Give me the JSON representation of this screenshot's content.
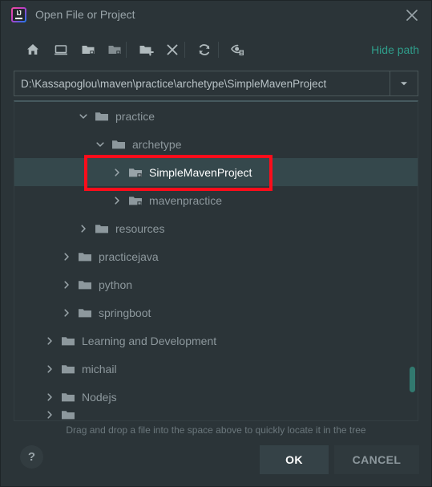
{
  "window": {
    "title": "Open File or Project",
    "app_icon": "intellij-idea-logo",
    "close_icon": "close-icon",
    "background": "#2b3438"
  },
  "toolbar": {
    "buttons": [
      {
        "name": "home-icon",
        "tooltip": "Home"
      },
      {
        "name": "desktop-icon",
        "tooltip": "Desktop"
      },
      {
        "name": "project-folder-icon",
        "tooltip": "Project Directory"
      },
      {
        "name": "folder-up-icon",
        "tooltip": "Up"
      },
      {
        "name": "new-folder-icon",
        "tooltip": "New Folder"
      },
      {
        "name": "delete-icon",
        "tooltip": "Delete"
      },
      {
        "name": "refresh-icon",
        "tooltip": "Refresh"
      },
      {
        "name": "show-hidden-files-icon",
        "tooltip": "Show Hidden Files and Directories"
      }
    ],
    "hide_path_label": "Hide path",
    "hide_path_color": "#2f9e8b"
  },
  "path_field": {
    "value": "D:\\Kassapoglou\\maven\\practice\\archetype\\SimpleMavenProject",
    "placeholder": "",
    "dropdown_icon": "chevron-down-icon"
  },
  "tree": {
    "rows": [
      {
        "label": "practice",
        "depth": 3,
        "arrow": "expanded",
        "icon": "folder-icon",
        "selected": false,
        "clipped": false
      },
      {
        "label": "archetype",
        "depth": 4,
        "arrow": "expanded",
        "icon": "folder-icon",
        "selected": false,
        "clipped": false
      },
      {
        "label": "SimpleMavenProject",
        "depth": 5,
        "arrow": "collapsed",
        "icon": "folder-module-icon",
        "selected": true,
        "clipped": false
      },
      {
        "label": "mavenpractice",
        "depth": 5,
        "arrow": "collapsed",
        "icon": "folder-module-icon",
        "selected": false,
        "clipped": false
      },
      {
        "label": "resources",
        "depth": 3,
        "arrow": "collapsed",
        "icon": "folder-icon",
        "selected": false,
        "clipped": false
      },
      {
        "label": "practicejava",
        "depth": 2,
        "arrow": "collapsed",
        "icon": "folder-icon",
        "selected": false,
        "clipped": false
      },
      {
        "label": "python",
        "depth": 2,
        "arrow": "collapsed",
        "icon": "folder-icon",
        "selected": false,
        "clipped": false
      },
      {
        "label": "springboot",
        "depth": 2,
        "arrow": "collapsed",
        "icon": "folder-icon",
        "selected": false,
        "clipped": false
      },
      {
        "label": "Learning and Development",
        "depth": 1,
        "arrow": "collapsed",
        "icon": "folder-icon",
        "selected": false,
        "clipped": false
      },
      {
        "label": "michail",
        "depth": 1,
        "arrow": "collapsed",
        "icon": "folder-icon",
        "selected": false,
        "clipped": false
      },
      {
        "label": "Nodejs",
        "depth": 1,
        "arrow": "collapsed",
        "icon": "folder-icon",
        "selected": false,
        "clipped": false
      },
      {
        "label": "",
        "depth": 1,
        "arrow": "collapsed",
        "icon": "folder-icon",
        "selected": false,
        "clipped": true
      }
    ],
    "scrollbar_color": "#32796f",
    "selected_row_background": "#35484c"
  },
  "annotation": {
    "shape": "rectangle",
    "target": "SimpleMavenProject",
    "color": "#fc0d1b"
  },
  "footer": {
    "drag_hint": "Drag and drop a file into the space above to quickly locate it in the tree",
    "help_label": "?",
    "ok_label": "OK",
    "cancel_label": "CANCEL"
  }
}
